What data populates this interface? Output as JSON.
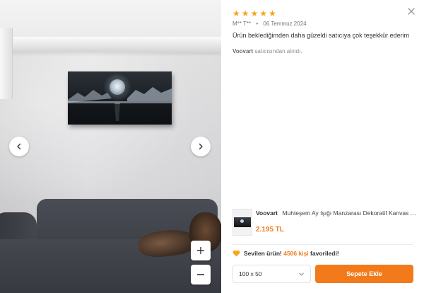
{
  "review": {
    "stars": [
      "★",
      "★",
      "★",
      "★",
      "★"
    ],
    "rating": 5,
    "author": "M** T**",
    "separator": "•",
    "date": "06 Temmuz 2024",
    "text": "Ürün beklediğimden daha güzeldi satıcıya çok teşekkür ederim",
    "seller_name": "Voovart",
    "seller_suffix": " satıcısından alındı."
  },
  "product": {
    "brand": "Voovart",
    "title": "Muhteşem Ay Işığı Manzarası Dekoratif Kanvas Tablo",
    "price": "2.195 TL"
  },
  "favorites": {
    "prefix": "Sevilen ürün!",
    "count": "4506 kişi",
    "suffix": "favoriledi!"
  },
  "size_select": {
    "value": "100 x 50"
  },
  "actions": {
    "add_to_cart": "Sepete Ekle",
    "zoom_in": "+",
    "zoom_out": "−"
  },
  "icons": {
    "prev": "chevron-left-icon",
    "next": "chevron-right-icon",
    "close": "close-icon",
    "heart": "heart-icon",
    "dropdown": "chevron-down-icon"
  },
  "colors": {
    "accent": "#f27a1a",
    "star": "#f7a21b",
    "heart": "#f5a623"
  }
}
